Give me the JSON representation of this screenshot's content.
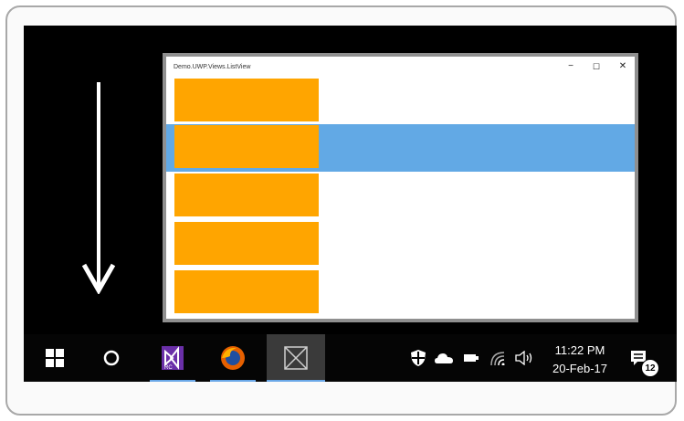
{
  "window": {
    "title": "Demo.UWP.Views.ListView",
    "minimize": "−",
    "maximize": "☐",
    "close": "✕",
    "selected_index": 1,
    "item_count": 5
  },
  "colors": {
    "item": "#ffa500",
    "selection": "#62a9e5",
    "taskbar": "#050505"
  },
  "taskbar": {
    "apps": [
      "windows-start-icon",
      "cortana-icon",
      "visual-studio-icon",
      "firefox-icon",
      "app-window-icon"
    ],
    "tray_icons": [
      "shield-icon",
      "onedrive-icon",
      "battery-icon",
      "wifi-icon",
      "volume-icon"
    ],
    "clock_time": "11:22 PM",
    "clock_date": "20-Feb-17",
    "notification_count": "12"
  }
}
